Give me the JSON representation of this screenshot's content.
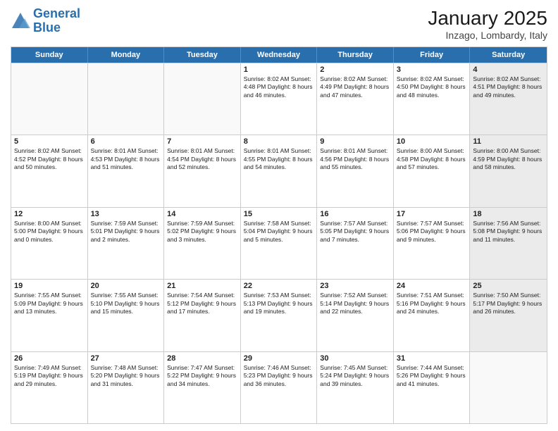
{
  "header": {
    "logo_line1": "General",
    "logo_line2": "Blue",
    "title": "January 2025",
    "subtitle": "Inzago, Lombardy, Italy"
  },
  "days_of_week": [
    "Sunday",
    "Monday",
    "Tuesday",
    "Wednesday",
    "Thursday",
    "Friday",
    "Saturday"
  ],
  "weeks": [
    [
      {
        "day": "",
        "info": "",
        "empty": true
      },
      {
        "day": "",
        "info": "",
        "empty": true
      },
      {
        "day": "",
        "info": "",
        "empty": true
      },
      {
        "day": "1",
        "info": "Sunrise: 8:02 AM\nSunset: 4:48 PM\nDaylight: 8 hours and 46 minutes."
      },
      {
        "day": "2",
        "info": "Sunrise: 8:02 AM\nSunset: 4:49 PM\nDaylight: 8 hours and 47 minutes."
      },
      {
        "day": "3",
        "info": "Sunrise: 8:02 AM\nSunset: 4:50 PM\nDaylight: 8 hours and 48 minutes."
      },
      {
        "day": "4",
        "info": "Sunrise: 8:02 AM\nSunset: 4:51 PM\nDaylight: 8 hours and 49 minutes.",
        "shaded": true
      }
    ],
    [
      {
        "day": "5",
        "info": "Sunrise: 8:02 AM\nSunset: 4:52 PM\nDaylight: 8 hours and 50 minutes."
      },
      {
        "day": "6",
        "info": "Sunrise: 8:01 AM\nSunset: 4:53 PM\nDaylight: 8 hours and 51 minutes."
      },
      {
        "day": "7",
        "info": "Sunrise: 8:01 AM\nSunset: 4:54 PM\nDaylight: 8 hours and 52 minutes."
      },
      {
        "day": "8",
        "info": "Sunrise: 8:01 AM\nSunset: 4:55 PM\nDaylight: 8 hours and 54 minutes."
      },
      {
        "day": "9",
        "info": "Sunrise: 8:01 AM\nSunset: 4:56 PM\nDaylight: 8 hours and 55 minutes."
      },
      {
        "day": "10",
        "info": "Sunrise: 8:00 AM\nSunset: 4:58 PM\nDaylight: 8 hours and 57 minutes."
      },
      {
        "day": "11",
        "info": "Sunrise: 8:00 AM\nSunset: 4:59 PM\nDaylight: 8 hours and 58 minutes.",
        "shaded": true
      }
    ],
    [
      {
        "day": "12",
        "info": "Sunrise: 8:00 AM\nSunset: 5:00 PM\nDaylight: 9 hours and 0 minutes."
      },
      {
        "day": "13",
        "info": "Sunrise: 7:59 AM\nSunset: 5:01 PM\nDaylight: 9 hours and 2 minutes."
      },
      {
        "day": "14",
        "info": "Sunrise: 7:59 AM\nSunset: 5:02 PM\nDaylight: 9 hours and 3 minutes."
      },
      {
        "day": "15",
        "info": "Sunrise: 7:58 AM\nSunset: 5:04 PM\nDaylight: 9 hours and 5 minutes."
      },
      {
        "day": "16",
        "info": "Sunrise: 7:57 AM\nSunset: 5:05 PM\nDaylight: 9 hours and 7 minutes."
      },
      {
        "day": "17",
        "info": "Sunrise: 7:57 AM\nSunset: 5:06 PM\nDaylight: 9 hours and 9 minutes."
      },
      {
        "day": "18",
        "info": "Sunrise: 7:56 AM\nSunset: 5:08 PM\nDaylight: 9 hours and 11 minutes.",
        "shaded": true
      }
    ],
    [
      {
        "day": "19",
        "info": "Sunrise: 7:55 AM\nSunset: 5:09 PM\nDaylight: 9 hours and 13 minutes."
      },
      {
        "day": "20",
        "info": "Sunrise: 7:55 AM\nSunset: 5:10 PM\nDaylight: 9 hours and 15 minutes."
      },
      {
        "day": "21",
        "info": "Sunrise: 7:54 AM\nSunset: 5:12 PM\nDaylight: 9 hours and 17 minutes."
      },
      {
        "day": "22",
        "info": "Sunrise: 7:53 AM\nSunset: 5:13 PM\nDaylight: 9 hours and 19 minutes."
      },
      {
        "day": "23",
        "info": "Sunrise: 7:52 AM\nSunset: 5:14 PM\nDaylight: 9 hours and 22 minutes."
      },
      {
        "day": "24",
        "info": "Sunrise: 7:51 AM\nSunset: 5:16 PM\nDaylight: 9 hours and 24 minutes."
      },
      {
        "day": "25",
        "info": "Sunrise: 7:50 AM\nSunset: 5:17 PM\nDaylight: 9 hours and 26 minutes.",
        "shaded": true
      }
    ],
    [
      {
        "day": "26",
        "info": "Sunrise: 7:49 AM\nSunset: 5:19 PM\nDaylight: 9 hours and 29 minutes."
      },
      {
        "day": "27",
        "info": "Sunrise: 7:48 AM\nSunset: 5:20 PM\nDaylight: 9 hours and 31 minutes."
      },
      {
        "day": "28",
        "info": "Sunrise: 7:47 AM\nSunset: 5:22 PM\nDaylight: 9 hours and 34 minutes."
      },
      {
        "day": "29",
        "info": "Sunrise: 7:46 AM\nSunset: 5:23 PM\nDaylight: 9 hours and 36 minutes."
      },
      {
        "day": "30",
        "info": "Sunrise: 7:45 AM\nSunset: 5:24 PM\nDaylight: 9 hours and 39 minutes."
      },
      {
        "day": "31",
        "info": "Sunrise: 7:44 AM\nSunset: 5:26 PM\nDaylight: 9 hours and 41 minutes."
      },
      {
        "day": "",
        "info": "",
        "empty": true,
        "shaded": true
      }
    ]
  ]
}
